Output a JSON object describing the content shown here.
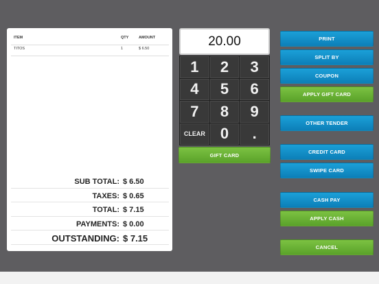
{
  "receipt": {
    "headers": {
      "item": "ITEM",
      "qty": "QTY",
      "amount": "AMOUNT"
    },
    "rows": [
      {
        "item": "TITOS",
        "qty": "1",
        "amount": "$ 6.50"
      }
    ],
    "totals": {
      "subtotal_label": "SUB TOTAL:",
      "subtotal_value": "$ 6.50",
      "taxes_label": "TAXES:",
      "taxes_value": "$ 0.65",
      "total_label": "TOTAL:",
      "total_value": "$ 7.15",
      "payments_label": "PAYMENTS:",
      "payments_value": "$ 0.00",
      "outstanding_label": "OUTSTANDING:",
      "outstanding_value": "$ 7.15"
    }
  },
  "keypad": {
    "display_value": "20.00",
    "keys": [
      "1",
      "2",
      "3",
      "4",
      "5",
      "6",
      "7",
      "8",
      "9",
      "CLEAR",
      "0",
      "."
    ],
    "gift_card_label": "GIFT CARD"
  },
  "actions": {
    "print": "PRINT",
    "split_by": "SPLIT BY",
    "coupon": "COUPON",
    "apply_gift_card": "APPLY GIFT CARD",
    "other_tender": "OTHER TENDER",
    "credit_card": "CREDIT CARD",
    "swipe_card": "SWIPE CARD",
    "cash_pay": "CASH PAY",
    "apply_cash": "APPLY CASH",
    "cancel": "CANCEL"
  },
  "colors": {
    "background": "#5e5d60",
    "blue_button": "#1593cc",
    "green_button": "#6cb436",
    "keypad": "#393939"
  }
}
